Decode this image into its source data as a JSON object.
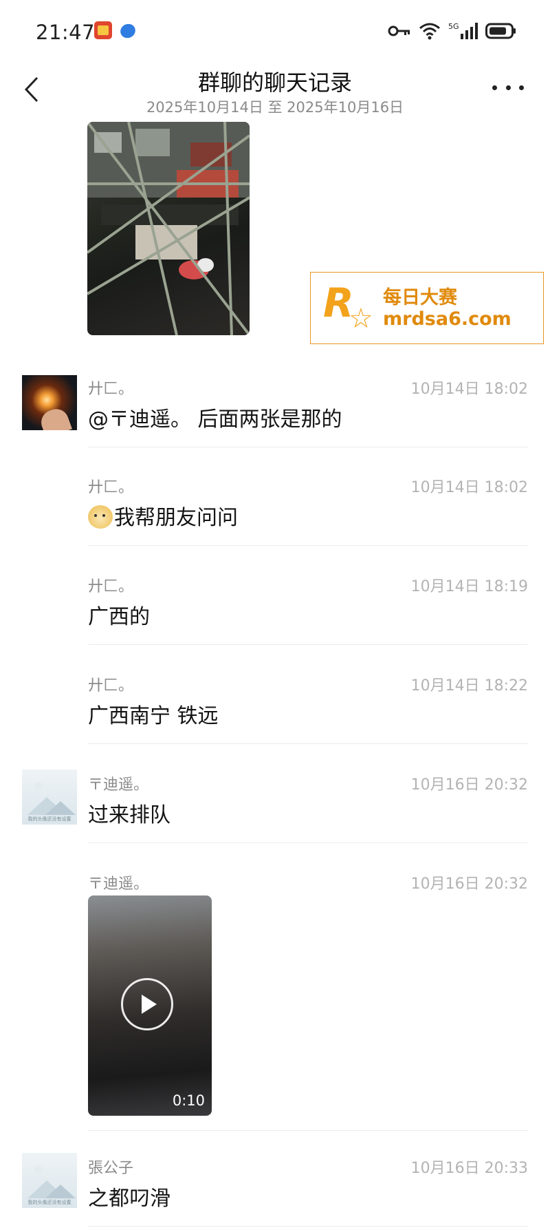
{
  "status_bar": {
    "time": "21:47",
    "network": "5G"
  },
  "header": {
    "title": "群聊的聊天记录",
    "subtitle": "2025年10月14日 至 2025年10月16日"
  },
  "watermark": {
    "logo_letter": "R",
    "logo_small": "每日大赛",
    "brand_cn": "每日大赛",
    "brand_url": "mrdsa6.com"
  },
  "messages": [
    {
      "sender": "廾匚。",
      "time": "10月14日 18:02",
      "text": "@〒迪遥。 后面两张是那的",
      "avatar": "sparkler"
    },
    {
      "sender": "廾匚。",
      "time": "10月14日 18:02",
      "text": "我帮朋友问问",
      "emoji": "doge"
    },
    {
      "sender": "廾匚。",
      "time": "10月14日 18:19",
      "text": "广西的"
    },
    {
      "sender": "廾匚。",
      "time": "10月14日 18:22",
      "text": "广西南宁 铁远"
    },
    {
      "sender": "〒迪遥。",
      "time": "10月16日 20:32",
      "text": "过来排队",
      "avatar": "default"
    },
    {
      "sender": "〒迪遥。",
      "time": "10月16日 20:32",
      "video_duration": "0:10"
    },
    {
      "sender": "張公子",
      "time": "10月16日 20:33",
      "text": "之都叼滑",
      "avatar": "default"
    }
  ],
  "default_avatar_caption": "我的头像还没有设置"
}
